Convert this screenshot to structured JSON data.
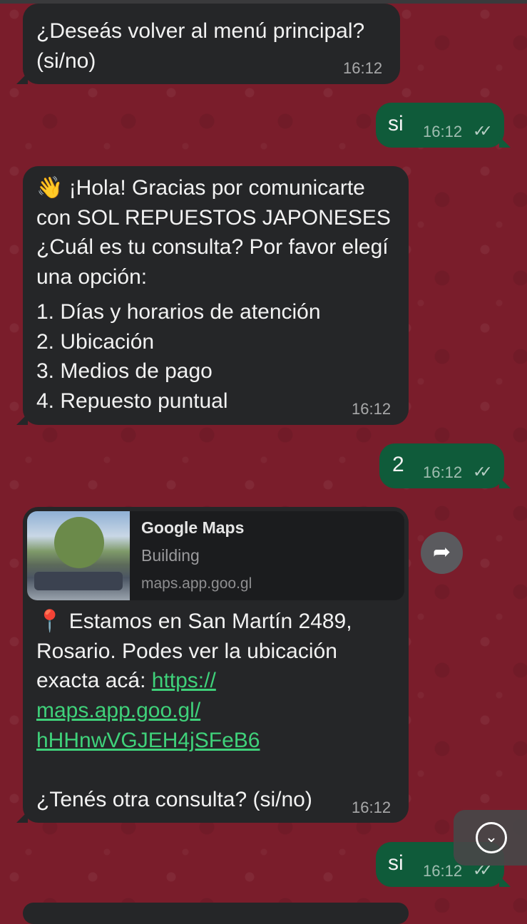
{
  "messages": [
    {
      "dir": "in",
      "text": "¿Deseás volver al menú principal? (si/no)",
      "time": "16:12"
    },
    {
      "dir": "out",
      "text": "si",
      "time": "16:12",
      "status": "read-double-check"
    },
    {
      "dir": "in",
      "emoji": "👋",
      "text": " ¡Hola! Gracias por comunicarte con SOL REPUESTOS JAPONESES ¿Cuál es tu consulta? Por favor elegí una opción:",
      "options": [
        "1. Días y horarios de atención",
        "2. Ubicación",
        "3. Medios de pago",
        "4. Repuesto puntual"
      ],
      "time": "16:12"
    },
    {
      "dir": "out",
      "text": "2",
      "time": "16:12",
      "status": "read-double-check"
    },
    {
      "dir": "in",
      "preview": {
        "title": "Google Maps",
        "subtitle": "Building",
        "domain": "maps.app.goo.gl"
      },
      "emoji": "📍",
      "text": " Estamos en San Martín 2489, Rosario. Podes ver la ubicación exacta acá: ",
      "link_lines": [
        "https://",
        "maps.app.goo.gl/",
        "hHHnwVGJEH4jSFeB6"
      ],
      "followup": "¿Tenés otra consulta? (si/no)",
      "time": "16:12"
    },
    {
      "dir": "out",
      "text": "si",
      "time": "16:12",
      "status": "read-double-check"
    }
  ],
  "icons": {
    "forward": "forward-arrow-icon",
    "scroll": "chevron-down-icon",
    "checks": "double-check-icon",
    "pin": "round-pushpin-emoji",
    "wave": "waving-hand-emoji"
  },
  "glyphs": {
    "checks": "✓✓",
    "forward": "➦",
    "chevron": "⌄"
  },
  "colors": {
    "wallpaper": "#7a1d2b",
    "incoming": "#252628",
    "outgoing": "#0f5b3a",
    "link": "#3fd17a"
  }
}
